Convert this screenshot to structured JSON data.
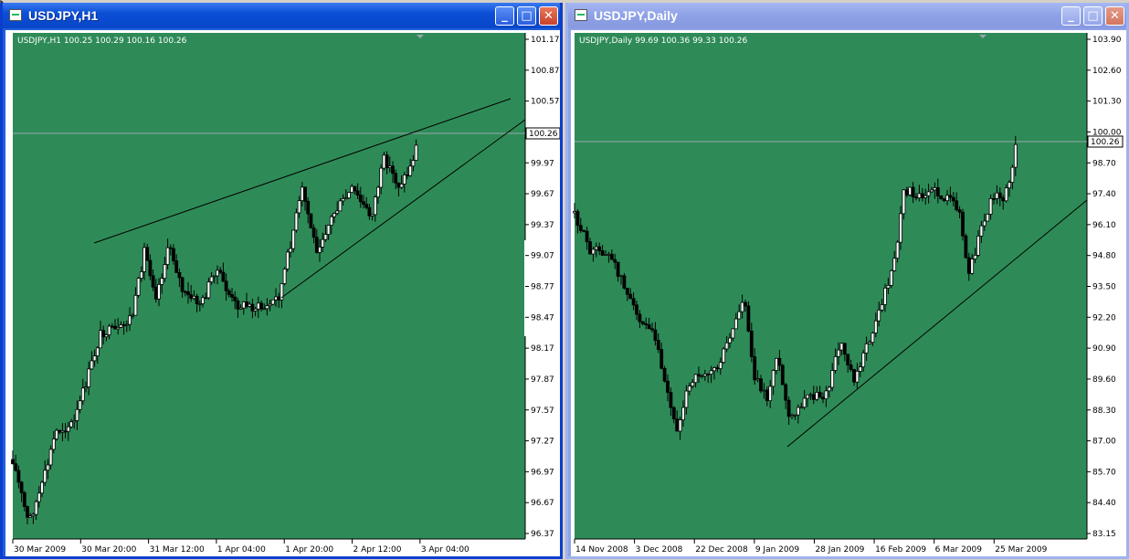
{
  "left_window": {
    "title": "USDJPY,H1",
    "info": "USDJPY,H1  100.25 100.29 100.16 100.26",
    "price_tag": "100.26",
    "price_ticks": [
      "101.17",
      "100.87",
      "100.57",
      "100.26",
      "99.97",
      "99.67",
      "99.37",
      "99.07",
      "98.77",
      "98.47",
      "98.17",
      "97.87",
      "97.57",
      "97.27",
      "96.97",
      "96.67",
      "96.37"
    ],
    "time_ticks": [
      "30 Mar 2009",
      "30 Mar 20:00",
      "31 Mar 12:00",
      "1 Apr 04:00",
      "1 Apr 20:00",
      "2 Apr 12:00",
      "3 Apr 04:00"
    ],
    "buttons": {
      "minimize": "_",
      "maximize": "□",
      "close": "✕"
    }
  },
  "right_window": {
    "title": "USDJPY,Daily",
    "info": "USDJPY,Daily  99.69 100.36 99.33 100.26",
    "price_tag": "100.26",
    "price_ticks": [
      "103.90",
      "102.60",
      "101.30",
      "100.00",
      "98.70",
      "97.40",
      "96.10",
      "94.80",
      "93.50",
      "92.20",
      "90.90",
      "89.60",
      "88.30",
      "87.00",
      "85.70",
      "84.40",
      "83.15"
    ],
    "time_ticks": [
      "14 Nov 2008",
      "3 Dec 2008",
      "22 Dec 2008",
      "9 Jan 2009",
      "28 Jan 2009",
      "16 Feb 2009",
      "6 Mar 2009",
      "25 Mar 2009"
    ],
    "buttons": {
      "minimize": "_",
      "maximize": "□",
      "close": "✕"
    }
  },
  "colors": {
    "chart_bg": "#2e8b57",
    "candle": "#000000",
    "grid_line": "#9aa6b2",
    "tag_bg": "#ffffff"
  }
}
